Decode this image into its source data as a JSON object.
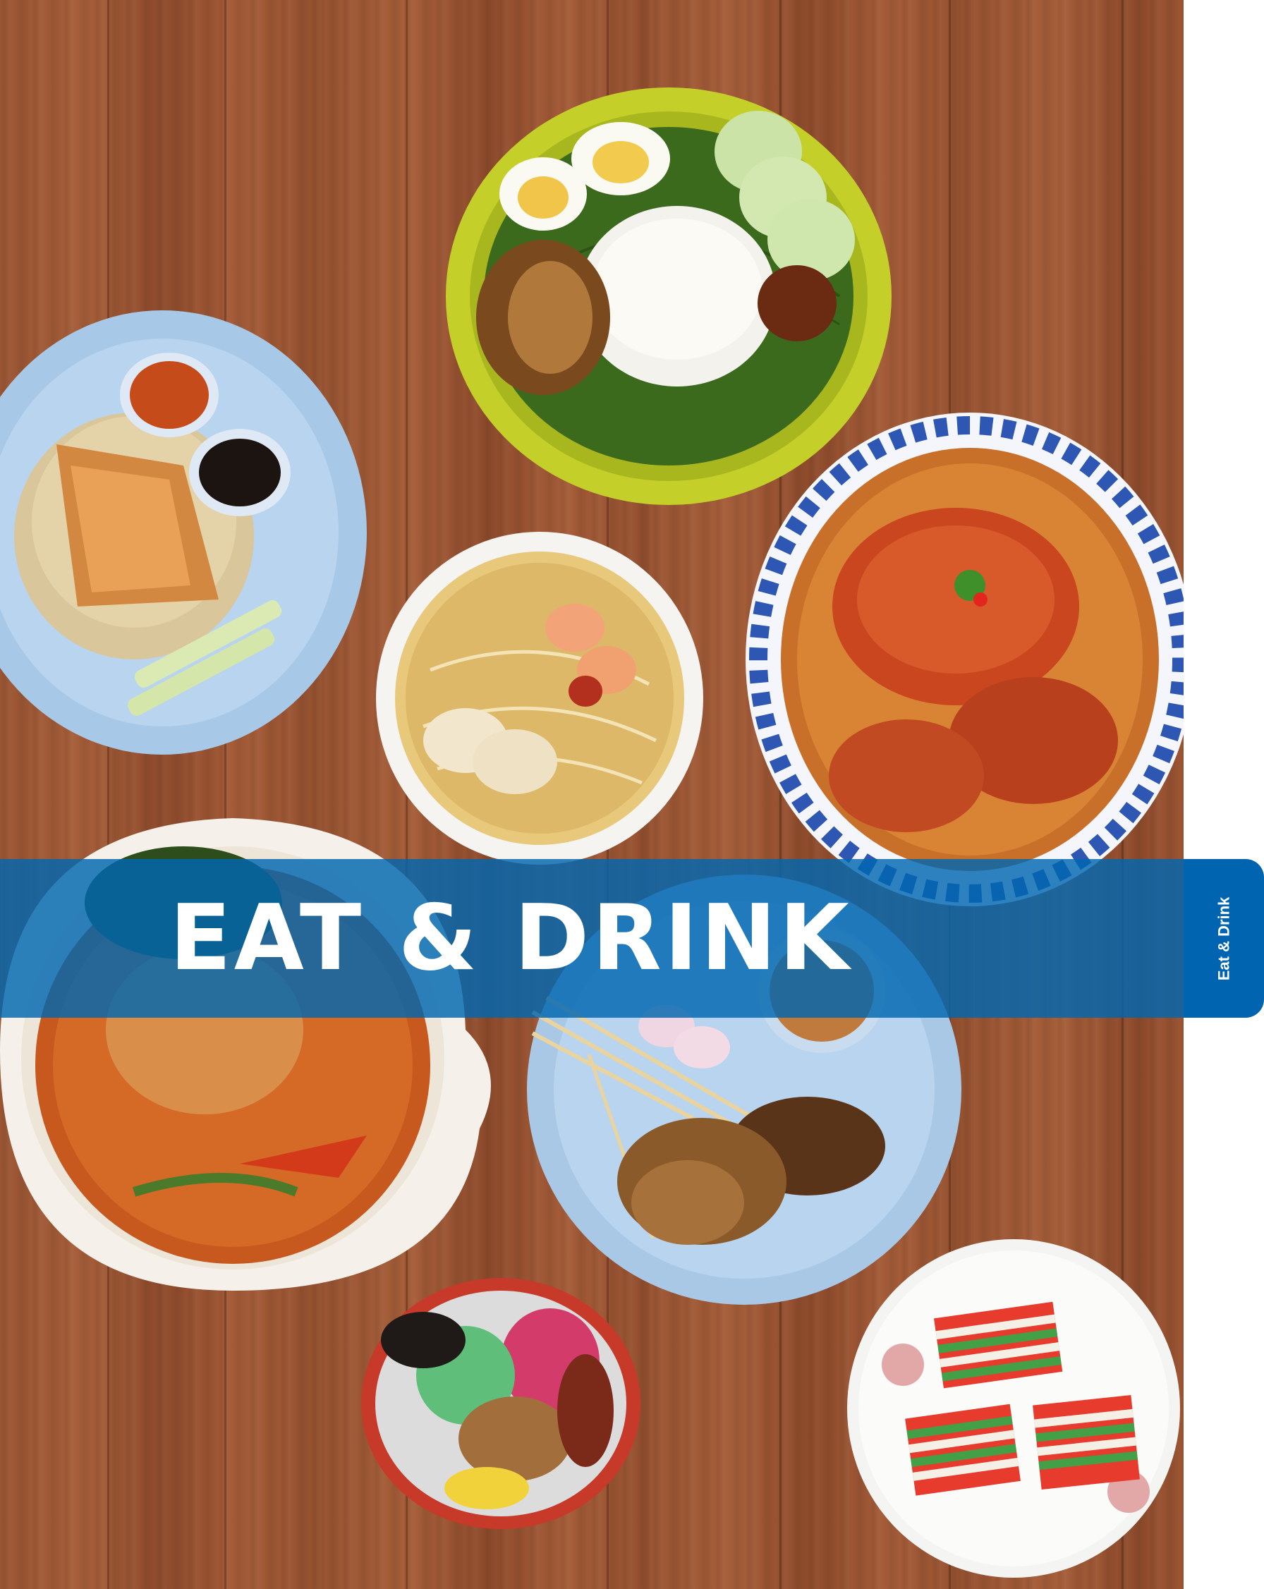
{
  "banner": {
    "title": "EAT & DRINK",
    "color": "#0066b0"
  },
  "side_tab": {
    "label": "Eat & Drink",
    "color": "#0064b0"
  },
  "photo": {
    "background": "wooden table with Singapore hawker dishes",
    "dishes": [
      "nasi-lemak",
      "chicken-rice",
      "laksa",
      "chilli-crab",
      "fish-head-curry",
      "satay",
      "ice-kachang",
      "kueh-lapis"
    ]
  }
}
